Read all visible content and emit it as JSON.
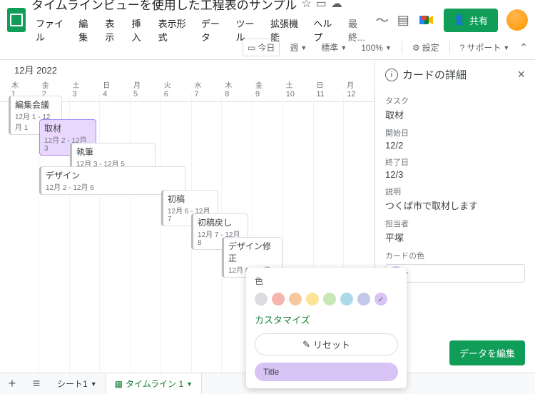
{
  "header": {
    "title": "タイムラインビューを使用した工程表のサンプル",
    "share_label": "共有",
    "menus": [
      "ファイル",
      "編集",
      "表示",
      "挿入",
      "表示形式",
      "データ",
      "ツール",
      "拡張機能",
      "ヘルプ"
    ],
    "last_edit": "最終..."
  },
  "toolbar": {
    "today": "今日",
    "scale": "週",
    "density": "標準",
    "zoom": "100%",
    "settings": "設定",
    "support": "サポート"
  },
  "timeline": {
    "month_label": "12月 2022",
    "days": [
      {
        "dow": "木",
        "num": "1"
      },
      {
        "dow": "金",
        "num": "2"
      },
      {
        "dow": "土",
        "num": "3"
      },
      {
        "dow": "日",
        "num": "4"
      },
      {
        "dow": "月",
        "num": "5"
      },
      {
        "dow": "火",
        "num": "6"
      },
      {
        "dow": "水",
        "num": "7"
      },
      {
        "dow": "木",
        "num": "8"
      },
      {
        "dow": "金",
        "num": "9"
      },
      {
        "dow": "土",
        "num": "10"
      },
      {
        "dow": "日",
        "num": "11"
      },
      {
        "dow": "月",
        "num": "12"
      }
    ],
    "cards": [
      {
        "title": "編集会議",
        "range": "12月 1 - 12月 1"
      },
      {
        "title": "取材",
        "range": "12月 2 - 12月 3"
      },
      {
        "title": "執筆",
        "range": "12月 3 - 12月 5"
      },
      {
        "title": "デザイン",
        "range": "12月 2 - 12月 6"
      },
      {
        "title": "初稿",
        "range": "12月 6 - 12月 7"
      },
      {
        "title": "初稿戻し",
        "range": "12月 7 - 12月 8"
      },
      {
        "title": "デザイン修正",
        "range": "12月 8 - 12月 9"
      }
    ]
  },
  "detail": {
    "panel_title": "カードの詳細",
    "labels": {
      "task": "タスク",
      "start": "開始日",
      "end": "終了日",
      "desc": "説明",
      "assignee": "担当者",
      "color": "カードの色"
    },
    "task": "取材",
    "start": "12/2",
    "end": "12/3",
    "desc": "つくば市で取材します",
    "assignee": "平塚",
    "edit_button": "データを編集"
  },
  "popup": {
    "label": "色",
    "customize": "カスタマイズ",
    "reset": "リセット",
    "title_pill": "Title",
    "swatches": [
      "#dadce0",
      "#f5b5ae",
      "#f7c8a0",
      "#fce49a",
      "#c8e7b5",
      "#aed9ea",
      "#c3c8e8",
      "#d7c4f5"
    ]
  },
  "tabs": {
    "sheet1": "シート1",
    "timeline1": "タイムライン 1"
  }
}
